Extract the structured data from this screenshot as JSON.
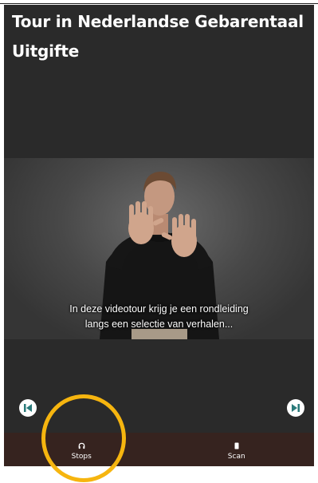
{
  "header": {
    "title_line1": "Tour in Nederlandse Gebarentaal",
    "title_line2": "Uitgifte"
  },
  "video": {
    "subtitle_line1": "In deze videotour krijg je een rondleiding",
    "subtitle_line2": "langs een selectie van verhalen..."
  },
  "controls": {
    "prev_icon": "skip-previous-icon",
    "next_icon": "skip-next-icon"
  },
  "tabbar": {
    "tabs": [
      {
        "label": "Stops",
        "icon": "headphones-icon"
      },
      {
        "label": "Scan",
        "icon": "scan-icon"
      }
    ]
  },
  "colors": {
    "app_background": "#2a2a2a",
    "tabbar_background": "#36231f",
    "nav_icon_color": "#2a7a7a",
    "highlight_ring": "#f6b50f"
  }
}
